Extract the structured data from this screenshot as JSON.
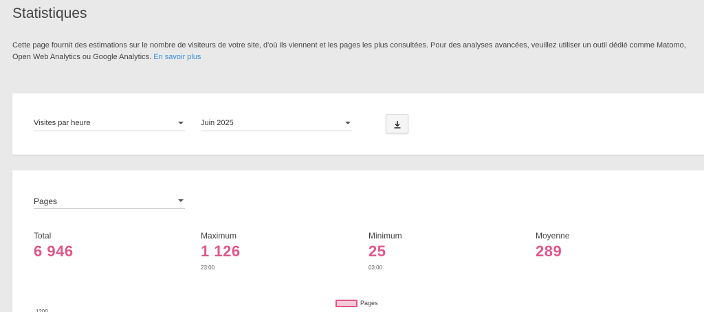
{
  "page": {
    "title": "Statistiques",
    "intro": "Cette page fournit des estimations sur le nombre de visiteurs de votre site, d'où ils viennent et les pages les plus consultées. Pour des analyses avancées, veuillez utiliser un outil dédié comme Matomo, Open Web Analytics ou Google Analytics.",
    "learn_more": "En savoir plus"
  },
  "controls": {
    "view_select": "Visites par heure",
    "period_select": "Juin 2025",
    "download_icon": "download-icon"
  },
  "stats": {
    "metric_select": "Pages",
    "total": {
      "label": "Total",
      "value": "6 946"
    },
    "maximum": {
      "label": "Maximum",
      "value": "1 126",
      "sub": "23:00"
    },
    "minimum": {
      "label": "Minimum",
      "value": "25",
      "sub": "03:00"
    },
    "average": {
      "label": "Moyenne",
      "value": "289"
    }
  },
  "chart": {
    "legend": "Pages",
    "y_tick_top": "1200"
  },
  "colors": {
    "accent": "#e0578a",
    "link": "#3d8fd6"
  }
}
